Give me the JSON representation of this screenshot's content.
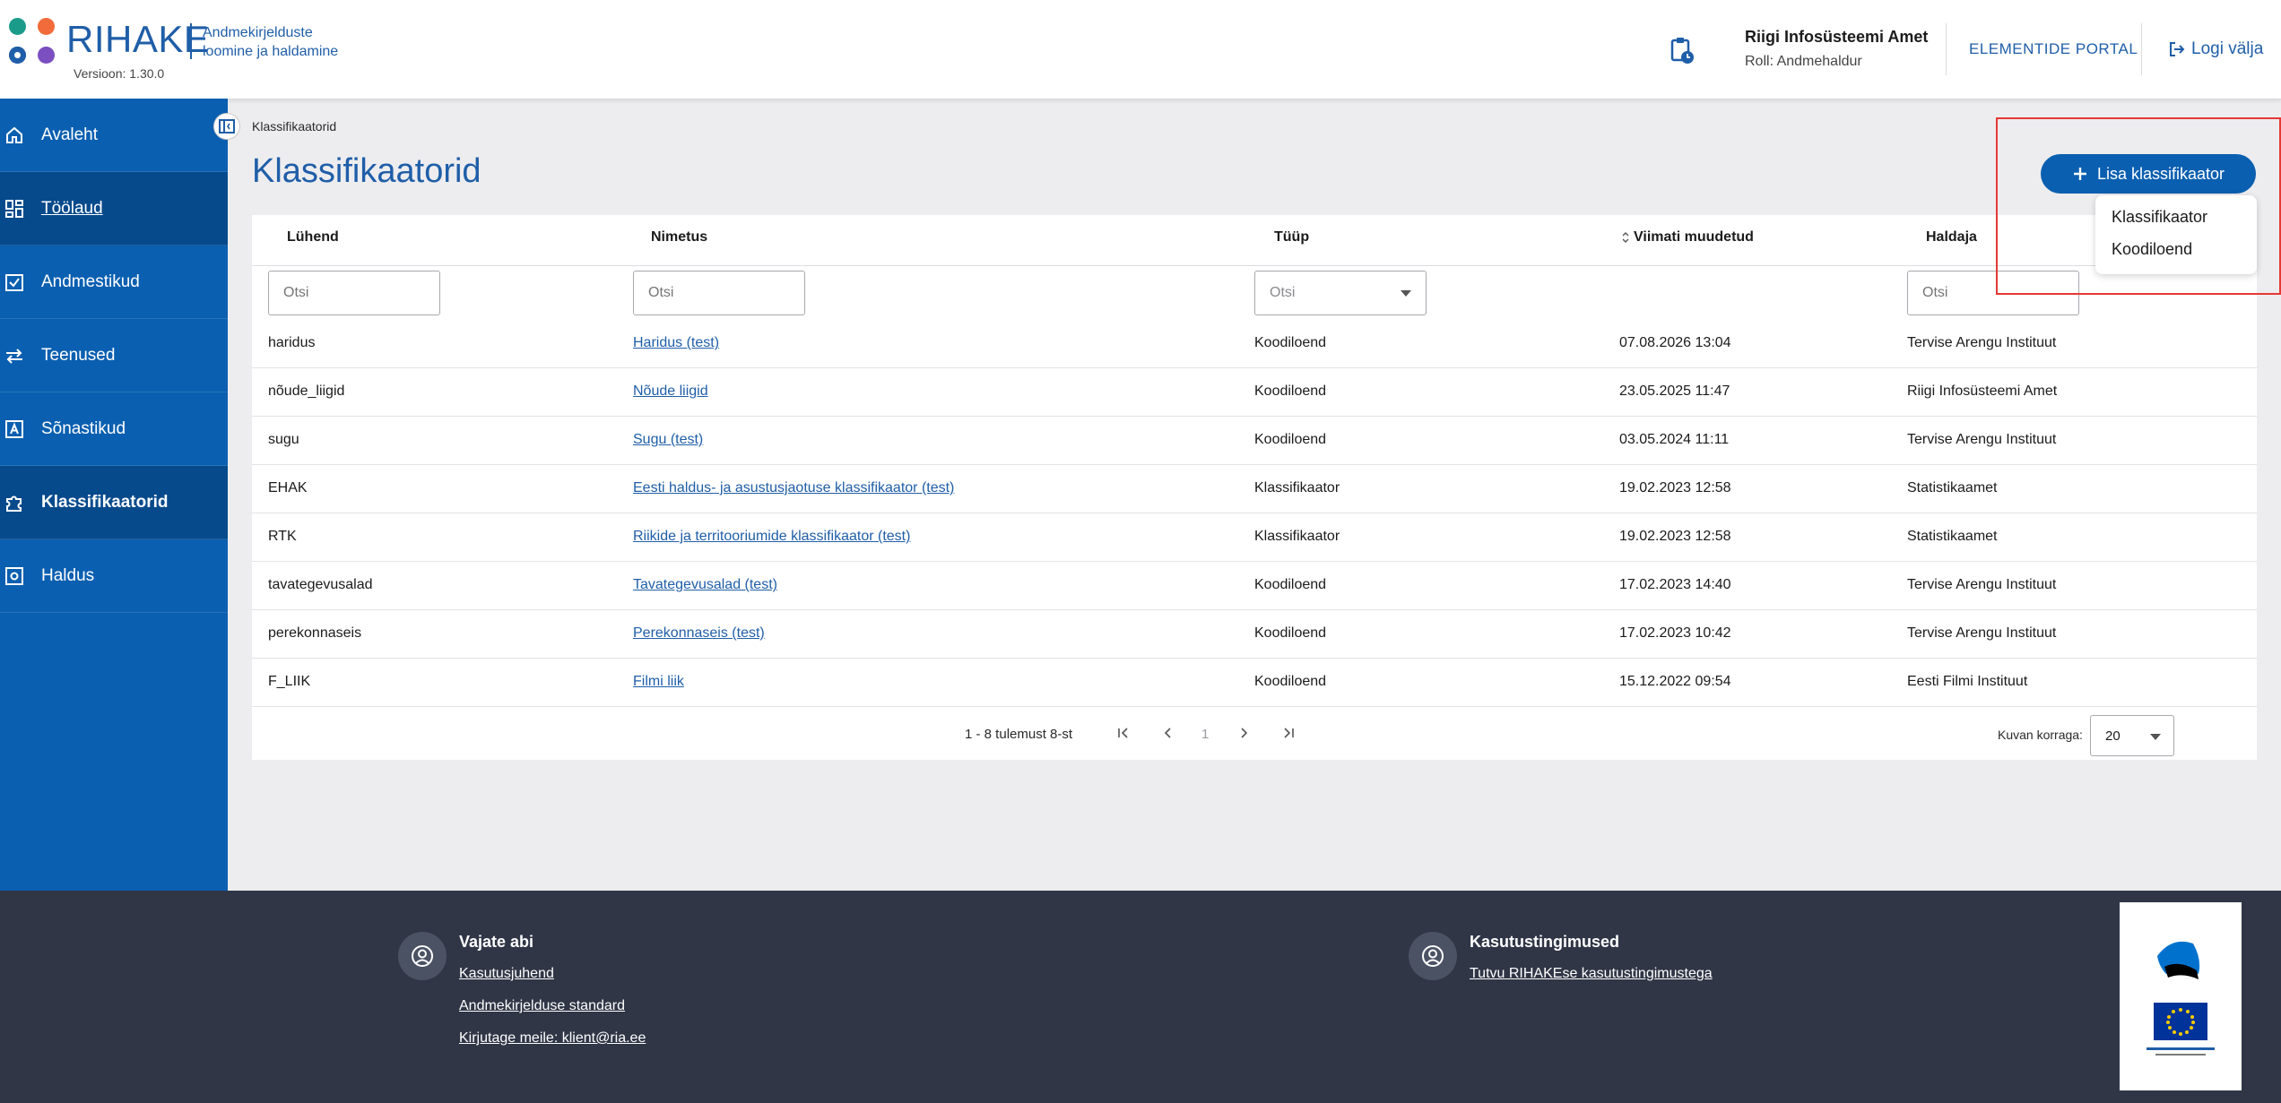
{
  "header": {
    "app_name": "RIHAKE",
    "app_subtitle_1": "Andmekirjelduste",
    "app_subtitle_2": "loomine ja haldamine",
    "version": "Versioon: 1.30.0",
    "org_name": "Riigi Infosüsteemi Amet",
    "role": "Roll: Andmehaldur",
    "external_link": "ELEMENTIDE PORTAL",
    "logout": "Logi välja",
    "logo_colors": [
      "#1a9b8a",
      "#f26b3a",
      "#1f5ea8",
      "#7b4fc0"
    ]
  },
  "sidebar": {
    "items": [
      {
        "label": "Avaleht",
        "icon": "home-icon"
      },
      {
        "label": "Töölaud",
        "icon": "dashboard-icon"
      },
      {
        "label": "Andmestikud",
        "icon": "checkbox-icon"
      },
      {
        "label": "Teenused",
        "icon": "arrows-icon"
      },
      {
        "label": "Sõnastikud",
        "icon": "dictionary-icon"
      },
      {
        "label": "Klassifikaatorid",
        "icon": "puzzle-icon"
      },
      {
        "label": "Haldus",
        "icon": "settings-icon"
      }
    ]
  },
  "main": {
    "breadcrumb": "Klassifikaatorid",
    "title": "Klassifikaatorid",
    "add_button": "Lisa klassifikaator",
    "dropdown": [
      "Klassifikaator",
      "Koodiloend"
    ],
    "columns": [
      "Lühend",
      "Nimetus",
      "Tüüp",
      "Viimati muudetud",
      "Haldaja"
    ],
    "filter_placeholder": "Otsi",
    "rows": [
      {
        "code": "haridus",
        "name": "Haridus (test)",
        "type": "Koodiloend",
        "modified": "07.08.2026 13:04",
        "owner": "Tervise Arengu Instituut"
      },
      {
        "code": "nõude_liigid",
        "name": "Nõude liigid",
        "type": "Koodiloend",
        "modified": "23.05.2025 11:47",
        "owner": "Riigi Infosüsteemi Amet"
      },
      {
        "code": "sugu",
        "name": "Sugu (test)",
        "type": "Koodiloend",
        "modified": "03.05.2024 11:11",
        "owner": "Tervise Arengu Instituut"
      },
      {
        "code": "EHAK",
        "name": "Eesti haldus- ja asustusjaotuse klassifikaator (test)",
        "type": "Klassifikaator",
        "modified": "19.02.2023 12:58",
        "owner": "Statistikaamet"
      },
      {
        "code": "RTK",
        "name": "Riikide ja territooriumide klassifikaator (test)",
        "type": "Klassifikaator",
        "modified": "19.02.2023 12:58",
        "owner": "Statistikaamet"
      },
      {
        "code": "tavategevusalad",
        "name": "Tavategevusalad (test)",
        "type": "Koodiloend",
        "modified": "17.02.2023 14:40",
        "owner": "Tervise Arengu Instituut"
      },
      {
        "code": "perekonnaseis",
        "name": "Perekonnaseis (test)",
        "type": "Koodiloend",
        "modified": "17.02.2023 10:42",
        "owner": "Tervise Arengu Instituut"
      },
      {
        "code": "F_LIIK",
        "name": "Filmi liik",
        "type": "Koodiloend",
        "modified": "15.12.2022 09:54",
        "owner": "Eesti Filmi Instituut"
      }
    ],
    "pagination": {
      "info": "1 - 8 tulemust 8-st",
      "page": "1",
      "per_page_label": "Kuvan korraga:",
      "per_page": "20"
    }
  },
  "footer": {
    "help_title": "Vajate abi",
    "help_links": [
      "Kasutusjuhend",
      "Andmekirjelduse standard",
      "Kirjutage meile: klient@ria.ee"
    ],
    "terms_title": "Kasutustingimused",
    "terms_link": "Tutvu RIHAKEse kasutustingimustega"
  }
}
